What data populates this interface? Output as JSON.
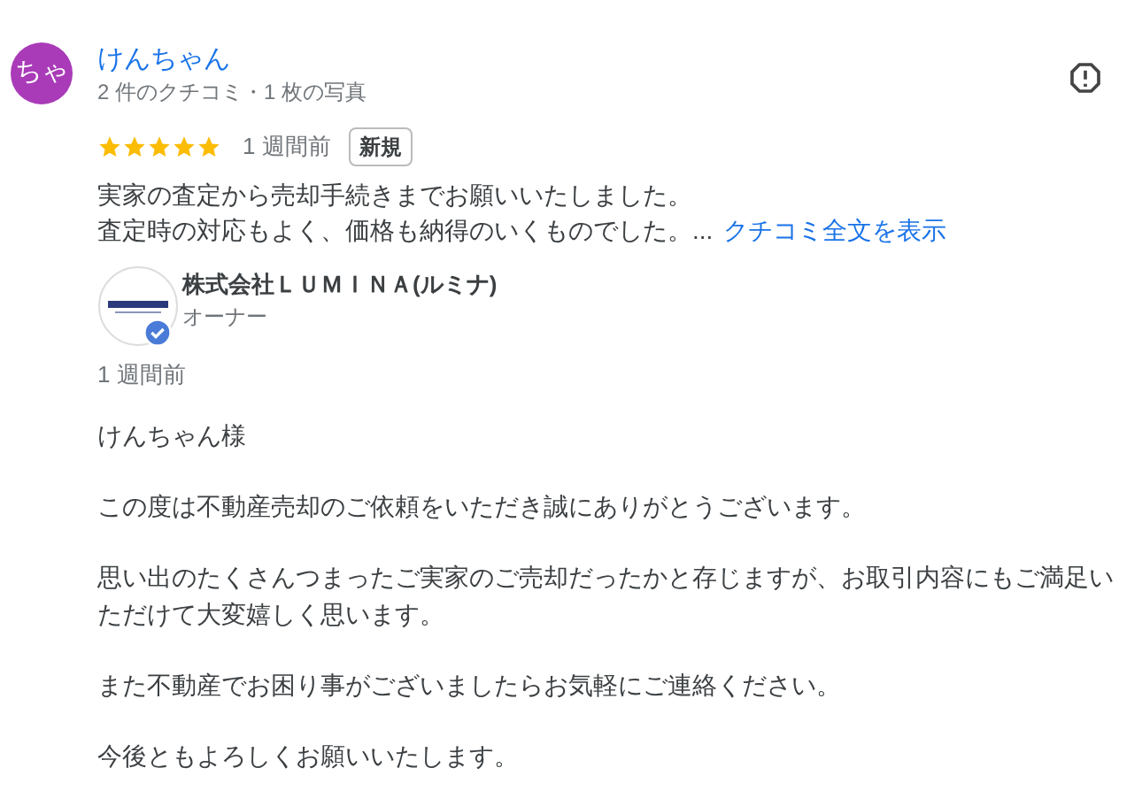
{
  "reviewer": {
    "avatar_text": "ちゃ",
    "name": "けんちゃん",
    "meta": "2 件のクチコミ・1 枚の写真"
  },
  "review": {
    "stars": 5,
    "time": "1 週間前",
    "badge": "新規",
    "lines": [
      "実家の査定から売却手続きまでお願いいたしました。",
      "査定時の対応もよく、価格も納得のいくものでした。..."
    ],
    "more_link": "クチコミ全文を表示"
  },
  "owner_reply": {
    "name": "株式会社ＬＵＭＩＮＡ(ルミナ)",
    "role": "オーナー",
    "verified": true,
    "time": "1 週間前",
    "paragraphs": [
      "けんちゃん様",
      "この度は不動産売却のご依頼をいただき誠にありがとうございます。",
      "思い出のたくさんつまったご実家のご売却だったかと存じますが、お取引内容にもご満足いただけて大変嬉しく思います。",
      "また不動産でお困り事がございましたらお気軽にご連絡ください。",
      "今後ともよろしくお願いいたします。"
    ]
  }
}
